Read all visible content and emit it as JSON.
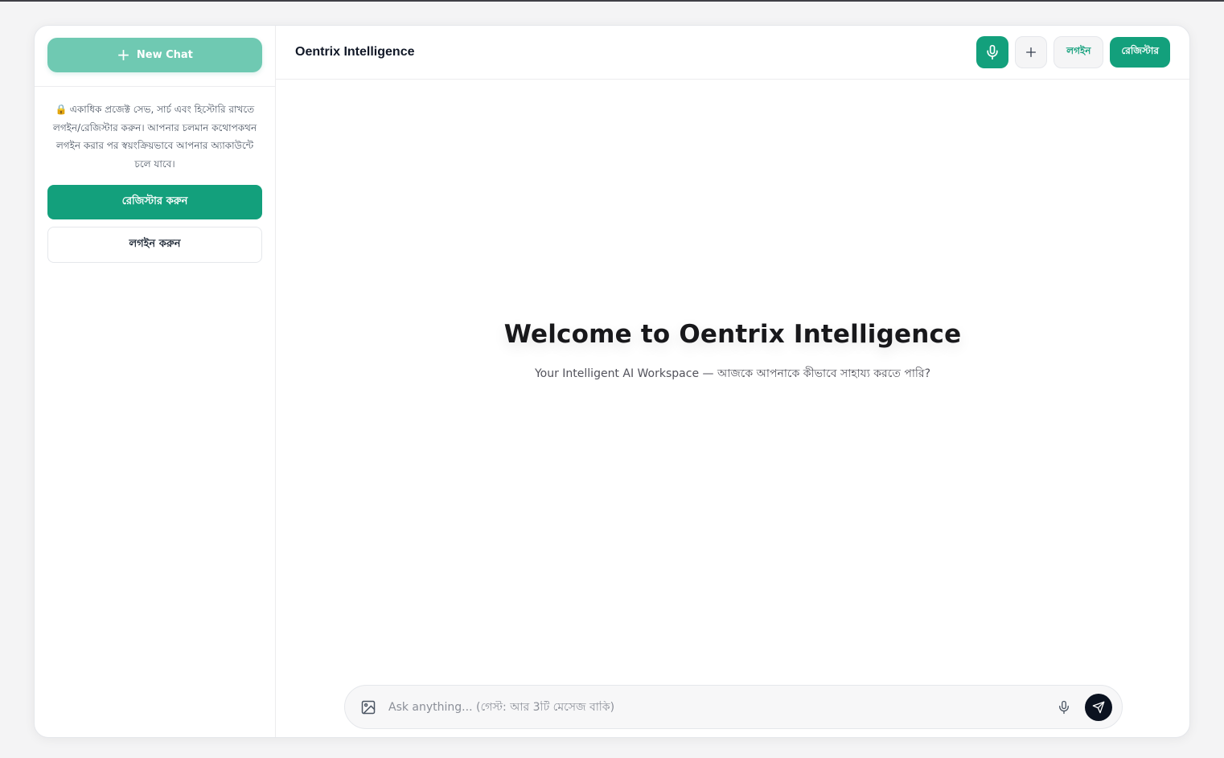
{
  "colors": {
    "accent": "#13a07c",
    "accent_light": "#6fc9b2",
    "send_button": "#0b1220"
  },
  "sidebar": {
    "new_chat_label": "New Chat",
    "new_chat_icon": "plus-icon",
    "notice_icon": "lock-icon",
    "notice_emoji": "🔒",
    "notice_text": "একাধিক প্রজেক্ট সেভ, সার্চ এবং হিস্টোরি রাখতে লগইন/রেজিস্টার করুন। আপনার চলমান কথোপকথন লগইন করার পর স্বয়ংক্রিয়ভাবে আপনার অ্যাকাউন্টে চলে যাবে।",
    "register_label": "রেজিস্টার করুন",
    "login_label": "লগইন করুন"
  },
  "header": {
    "title": "Oentrix Intelligence",
    "mic_icon": "microphone-icon",
    "add_icon": "plus-icon",
    "login_label": "লগইন",
    "register_label": "রেজিস্টার"
  },
  "welcome": {
    "heading": "Welcome to Oentrix Intelligence",
    "subtitle": "Your Intelligent AI Workspace — আজকে আপনাকে কীভাবে সাহায্য করতে পারি?"
  },
  "composer": {
    "image_icon": "image-icon",
    "placeholder": "Ask anything... (গেস্ট: আর 3টি মেসেজ বাকি)",
    "mic_icon": "microphone-icon",
    "send_icon": "send-icon"
  }
}
